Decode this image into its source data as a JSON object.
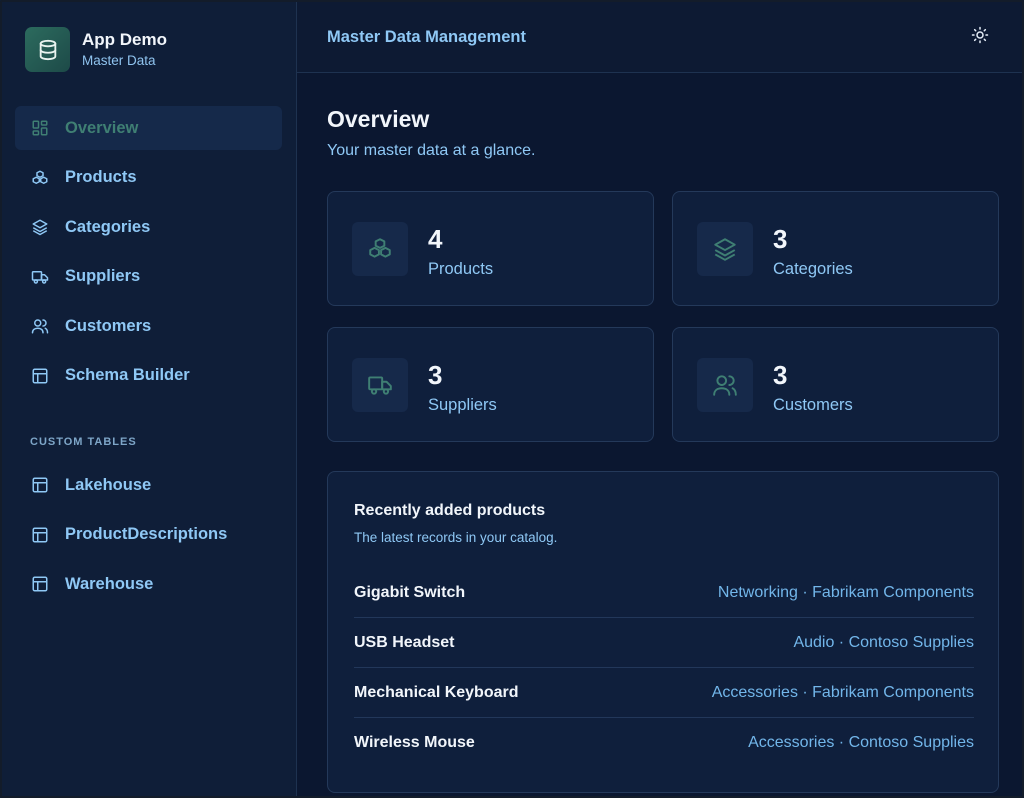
{
  "brand": {
    "title": "App Demo",
    "subtitle": "Master Data"
  },
  "nav": [
    {
      "label": "Overview",
      "icon": "dashboard-icon",
      "active": true
    },
    {
      "label": "Products",
      "icon": "boxes-icon"
    },
    {
      "label": "Categories",
      "icon": "layers-icon"
    },
    {
      "label": "Suppliers",
      "icon": "truck-icon"
    },
    {
      "label": "Customers",
      "icon": "users-icon"
    },
    {
      "label": "Schema Builder",
      "icon": "table-icon"
    }
  ],
  "custom_tables": {
    "title": "CUSTOM TABLES",
    "items": [
      {
        "label": "Lakehouse",
        "icon": "table-icon"
      },
      {
        "label": "ProductDescriptions",
        "icon": "table-icon"
      },
      {
        "label": "Warehouse",
        "icon": "table-icon"
      }
    ]
  },
  "header": {
    "title": "Master Data Management",
    "theme_icon": "sun-icon"
  },
  "overview": {
    "title": "Overview",
    "subtitle": "Your master data at a glance.",
    "cards": [
      {
        "count": "4",
        "label": "Products",
        "icon": "boxes-icon"
      },
      {
        "count": "3",
        "label": "Categories",
        "icon": "layers-icon"
      },
      {
        "count": "3",
        "label": "Suppliers",
        "icon": "truck-icon"
      },
      {
        "count": "3",
        "label": "Customers",
        "icon": "users-icon"
      }
    ]
  },
  "recent": {
    "title": "Recently added products",
    "subtitle": "The latest records in your catalog.",
    "rows": [
      {
        "name": "Gigabit Switch",
        "meta": "Networking · Fabrikam Components"
      },
      {
        "name": "USB Headset",
        "meta": "Audio · Contoso Supplies"
      },
      {
        "name": "Mechanical Keyboard",
        "meta": "Accessories · Fabrikam Components"
      },
      {
        "name": "Wireless Mouse",
        "meta": "Accessories · Contoso Supplies"
      }
    ]
  },
  "colors": {
    "accent": "#3f7f73",
    "link": "#8fc8f5",
    "background": "#0b1730",
    "sidebar": "#0f1e38"
  }
}
